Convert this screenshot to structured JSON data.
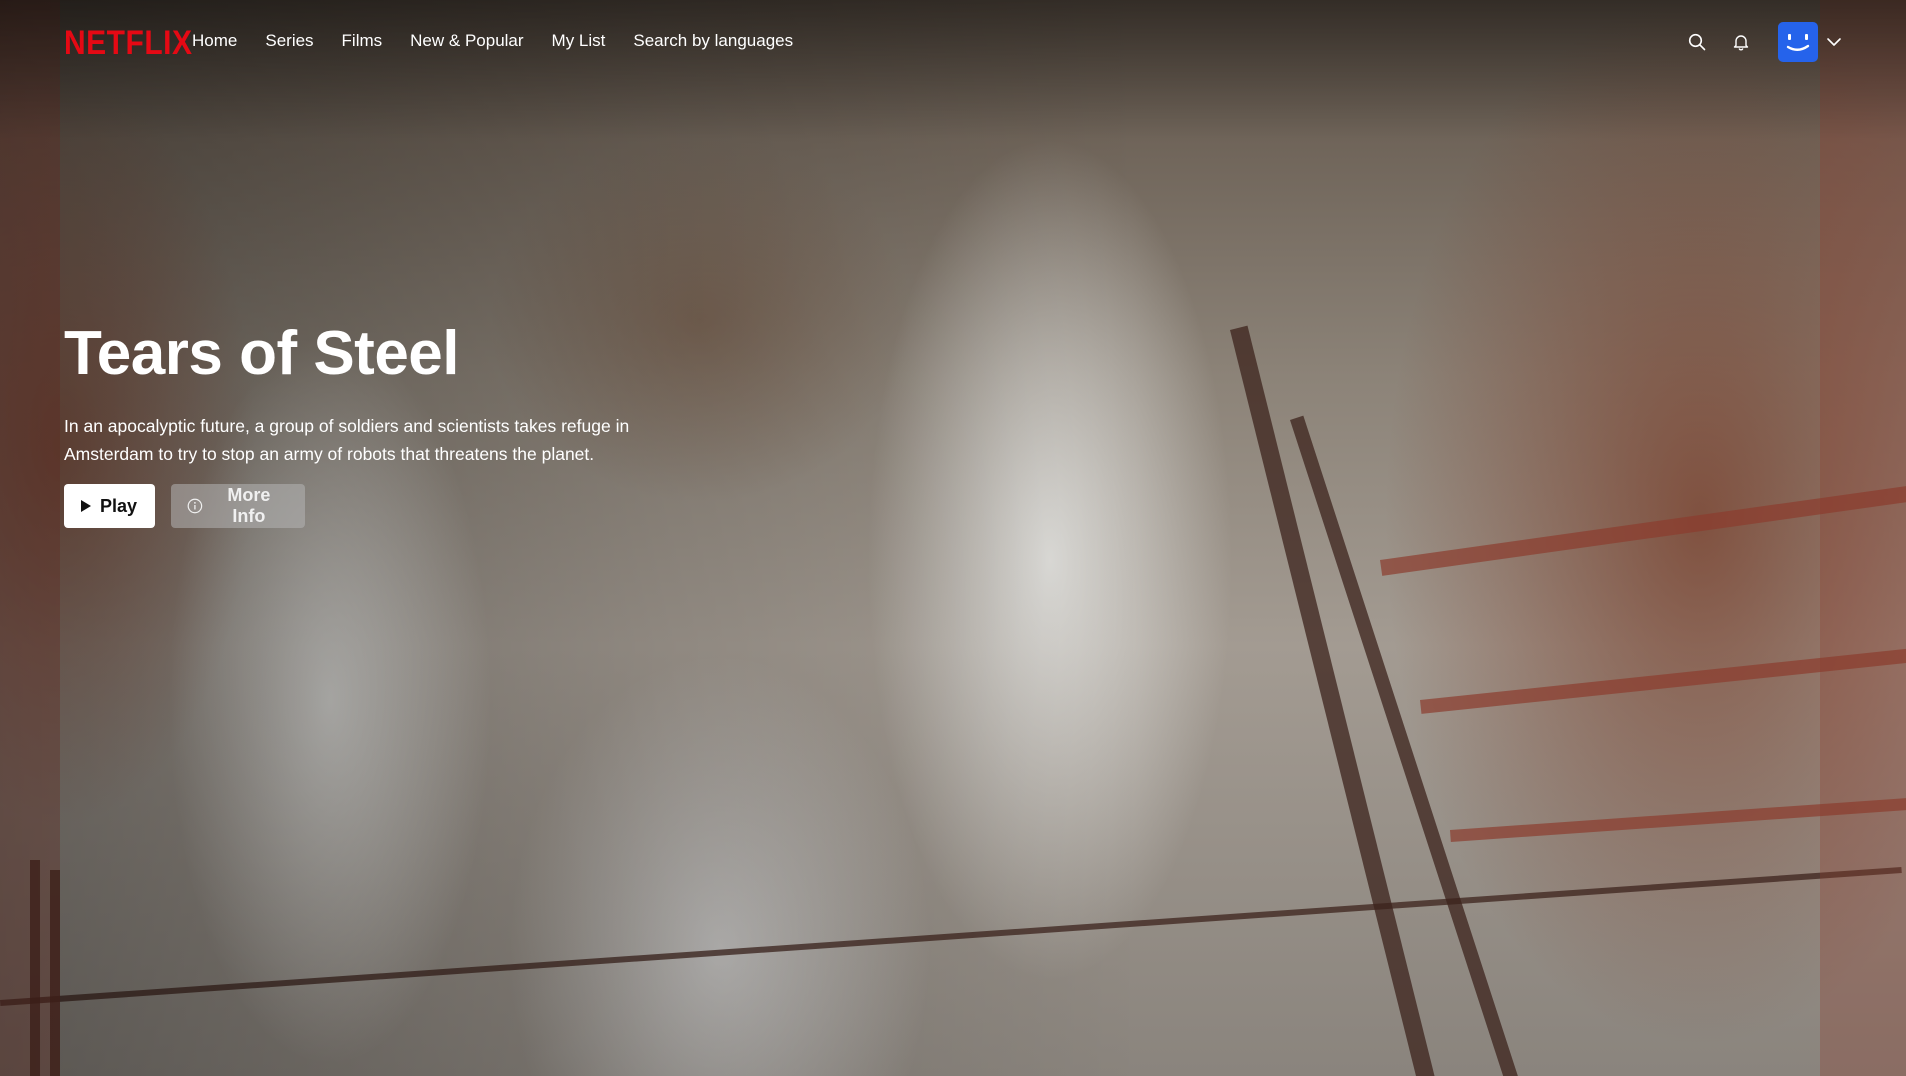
{
  "brand": {
    "logo_text": "NETFLIX",
    "color": "#e50914"
  },
  "nav": {
    "items": [
      {
        "label": "Home"
      },
      {
        "label": "Series"
      },
      {
        "label": "Films"
      },
      {
        "label": "New & Popular"
      },
      {
        "label": "My List"
      },
      {
        "label": "Search by languages"
      }
    ]
  },
  "header_icons": {
    "search": "search-icon",
    "notifications": "bell-icon",
    "avatar": "profile-avatar",
    "avatar_color": "#2563eb",
    "menu": "chevron-down-icon"
  },
  "hero": {
    "title": "Tears of Steel",
    "description": "In an apocalyptic future, a group of soldiers and scientists takes refuge in Amsterdam to try to stop an army of robots that threatens the planet.",
    "play_label": "Play",
    "more_info_label": "More Info"
  }
}
